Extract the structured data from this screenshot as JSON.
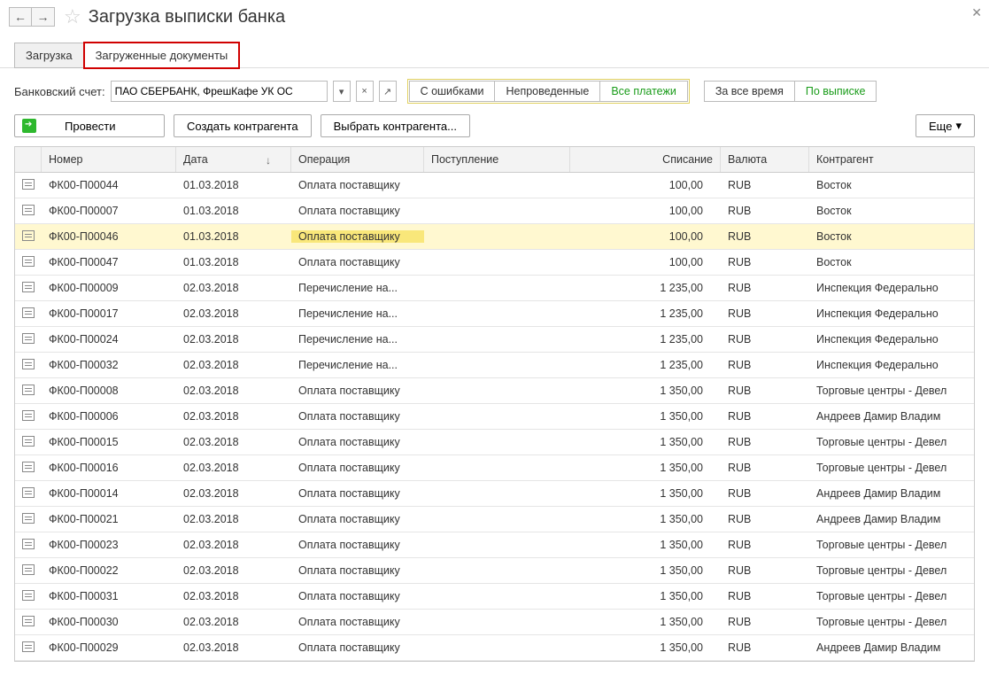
{
  "header": {
    "title": "Загрузка выписки банка"
  },
  "tabs": {
    "load": "Загрузка",
    "loaded": "Загруженные документы"
  },
  "filter": {
    "account_label": "Банковский счет:",
    "account_value": "ПАО СБЕРБАНК, ФрешКафе УК ОС",
    "seg_errors": "С ошибками",
    "seg_unposted": "Непроведенные",
    "seg_all": "Все платежи",
    "period_all": "За все время",
    "period_statement": "По выписке"
  },
  "actions": {
    "post": "Провести",
    "create_counterparty": "Создать контрагента",
    "select_counterparty": "Выбрать контрагента...",
    "more": "Еще"
  },
  "columns": {
    "number": "Номер",
    "date": "Дата",
    "operation": "Операция",
    "income": "Поступление",
    "outcome": "Списание",
    "currency": "Валюта",
    "counterparty": "Контрагент"
  },
  "rows": [
    {
      "num": "ФК00-П00044",
      "date": "01.03.2018",
      "op": "Оплата поставщику",
      "in": "",
      "out": "100,00",
      "cur": "RUB",
      "ctr": "Восток",
      "sel": false
    },
    {
      "num": "ФК00-П00007",
      "date": "01.03.2018",
      "op": "Оплата поставщику",
      "in": "",
      "out": "100,00",
      "cur": "RUB",
      "ctr": "Восток",
      "sel": false
    },
    {
      "num": "ФК00-П00046",
      "date": "01.03.2018",
      "op": "Оплата поставщику",
      "in": "",
      "out": "100,00",
      "cur": "RUB",
      "ctr": "Восток",
      "sel": true
    },
    {
      "num": "ФК00-П00047",
      "date": "01.03.2018",
      "op": "Оплата поставщику",
      "in": "",
      "out": "100,00",
      "cur": "RUB",
      "ctr": "Восток",
      "sel": false
    },
    {
      "num": "ФК00-П00009",
      "date": "02.03.2018",
      "op": "Перечисление на...",
      "in": "",
      "out": "1 235,00",
      "cur": "RUB",
      "ctr": "Инспекция Федерально",
      "sel": false
    },
    {
      "num": "ФК00-П00017",
      "date": "02.03.2018",
      "op": "Перечисление на...",
      "in": "",
      "out": "1 235,00",
      "cur": "RUB",
      "ctr": "Инспекция Федерально",
      "sel": false
    },
    {
      "num": "ФК00-П00024",
      "date": "02.03.2018",
      "op": "Перечисление на...",
      "in": "",
      "out": "1 235,00",
      "cur": "RUB",
      "ctr": "Инспекция Федерально",
      "sel": false
    },
    {
      "num": "ФК00-П00032",
      "date": "02.03.2018",
      "op": "Перечисление на...",
      "in": "",
      "out": "1 235,00",
      "cur": "RUB",
      "ctr": "Инспекция Федерально",
      "sel": false
    },
    {
      "num": "ФК00-П00008",
      "date": "02.03.2018",
      "op": "Оплата поставщику",
      "in": "",
      "out": "1 350,00",
      "cur": "RUB",
      "ctr": "Торговые центры - Девел",
      "sel": false
    },
    {
      "num": "ФК00-П00006",
      "date": "02.03.2018",
      "op": "Оплата поставщику",
      "in": "",
      "out": "1 350,00",
      "cur": "RUB",
      "ctr": "Андреев Дамир Владим",
      "sel": false
    },
    {
      "num": "ФК00-П00015",
      "date": "02.03.2018",
      "op": "Оплата поставщику",
      "in": "",
      "out": "1 350,00",
      "cur": "RUB",
      "ctr": "Торговые центры - Девел",
      "sel": false
    },
    {
      "num": "ФК00-П00016",
      "date": "02.03.2018",
      "op": "Оплата поставщику",
      "in": "",
      "out": "1 350,00",
      "cur": "RUB",
      "ctr": "Торговые центры - Девел",
      "sel": false
    },
    {
      "num": "ФК00-П00014",
      "date": "02.03.2018",
      "op": "Оплата поставщику",
      "in": "",
      "out": "1 350,00",
      "cur": "RUB",
      "ctr": "Андреев Дамир Владим",
      "sel": false
    },
    {
      "num": "ФК00-П00021",
      "date": "02.03.2018",
      "op": "Оплата поставщику",
      "in": "",
      "out": "1 350,00",
      "cur": "RUB",
      "ctr": "Андреев Дамир Владим",
      "sel": false
    },
    {
      "num": "ФК00-П00023",
      "date": "02.03.2018",
      "op": "Оплата поставщику",
      "in": "",
      "out": "1 350,00",
      "cur": "RUB",
      "ctr": "Торговые центры - Девел",
      "sel": false
    },
    {
      "num": "ФК00-П00022",
      "date": "02.03.2018",
      "op": "Оплата поставщику",
      "in": "",
      "out": "1 350,00",
      "cur": "RUB",
      "ctr": "Торговые центры - Девел",
      "sel": false
    },
    {
      "num": "ФК00-П00031",
      "date": "02.03.2018",
      "op": "Оплата поставщику",
      "in": "",
      "out": "1 350,00",
      "cur": "RUB",
      "ctr": "Торговые центры - Девел",
      "sel": false
    },
    {
      "num": "ФК00-П00030",
      "date": "02.03.2018",
      "op": "Оплата поставщику",
      "in": "",
      "out": "1 350,00",
      "cur": "RUB",
      "ctr": "Торговые центры - Девел",
      "sel": false
    },
    {
      "num": "ФК00-П00029",
      "date": "02.03.2018",
      "op": "Оплата поставщику",
      "in": "",
      "out": "1 350,00",
      "cur": "RUB",
      "ctr": "Андреев Дамир Владим",
      "sel": false
    }
  ]
}
